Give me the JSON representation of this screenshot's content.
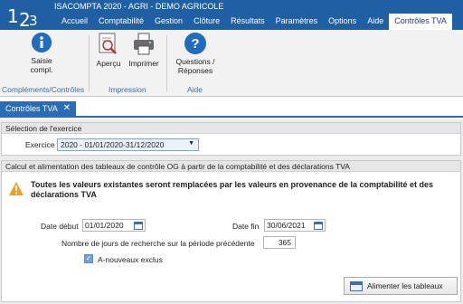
{
  "app": {
    "logo_digits": [
      "1",
      "2",
      "3"
    ],
    "title": "ISACOMPTA 2020 - AGRI - DEMO AGRICOLE"
  },
  "menu": {
    "items": [
      "Accueil",
      "Comptabilité",
      "Gestion",
      "Clôture",
      "Résultats",
      "Paramètres",
      "Options",
      "Aide",
      "Contrôles TVA"
    ],
    "active": "Contrôles TVA"
  },
  "ribbon": {
    "saisie_label": "Saisie\ncompl.",
    "apercu_label": "Aperçu",
    "imprimer_label": "Imprimer",
    "questions_label": "Questions /\nRéponses",
    "group_complements": "Compléments/Contrôles",
    "group_impression": "Impression",
    "group_aide": "Aide"
  },
  "doc_tab": {
    "label": "Contrôles TVA",
    "close": "✕"
  },
  "exercice_section": {
    "title": "Sélection de l'exercice",
    "label": "Exercice",
    "value": "2020 - 01/01/2020-31/12/2020"
  },
  "calc_section": {
    "title": "Calcul et alimentation des tableaux de contrôle OG à partir de la comptabilité et des déclarations TVA",
    "warning": "Toutes les valeurs existantes seront remplacées par les valeurs en provenance de la comptabilité et des déclarations TVA",
    "date_debut_label": "Date début",
    "date_debut_value": "01/01/2020",
    "date_fin_label": "Date fin",
    "date_fin_value": "30/06/2021",
    "jours_label": "Nombre de jours de recherche sur la période précédente",
    "jours_value": "365",
    "anouveaux_label": "A-nouveaux exclus",
    "anouveaux_checked": true,
    "button_label": "Alimenter les tableaux"
  },
  "colors": {
    "title_bar": "#1f5fa3",
    "accent": "#2a6cb5",
    "warning": "#f0a020",
    "info_icon": "#1e6dc0"
  }
}
